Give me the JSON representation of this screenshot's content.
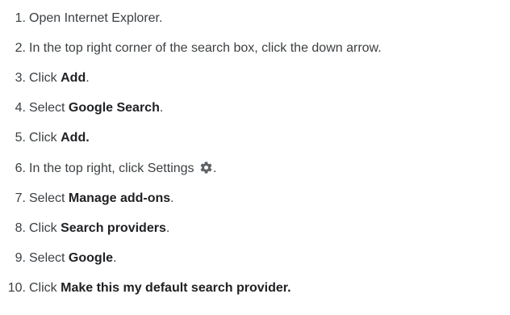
{
  "steps": [
    {
      "num": "1.",
      "pre": "Open Internet Explorer.",
      "bold": "",
      "post": ""
    },
    {
      "num": "2.",
      "pre": "In the top right corner of the search box, click the down arrow.",
      "bold": "",
      "post": ""
    },
    {
      "num": "3.",
      "pre": "Click ",
      "bold": "Add",
      "post": "."
    },
    {
      "num": "4.",
      "pre": "Select ",
      "bold": "Google Search",
      "post": "."
    },
    {
      "num": "5.",
      "pre": "Click ",
      "bold": "Add.",
      "post": ""
    },
    {
      "num": "6.",
      "pre": "In the top right, click Settings ",
      "bold": "",
      "post": "."
    },
    {
      "num": "7.",
      "pre": "Select ",
      "bold": "Manage add-ons",
      "post": "."
    },
    {
      "num": "8.",
      "pre": "Click ",
      "bold": "Search providers",
      "post": "."
    },
    {
      "num": "9.",
      "pre": "Select ",
      "bold": "Google",
      "post": "."
    },
    {
      "num": "10.",
      "pre": "Click ",
      "bold": "Make this my default search provider.",
      "post": ""
    }
  ],
  "icons": {
    "settings": "gear-icon"
  },
  "colors": {
    "text": "#3c4043",
    "icon": "#5f6368"
  }
}
